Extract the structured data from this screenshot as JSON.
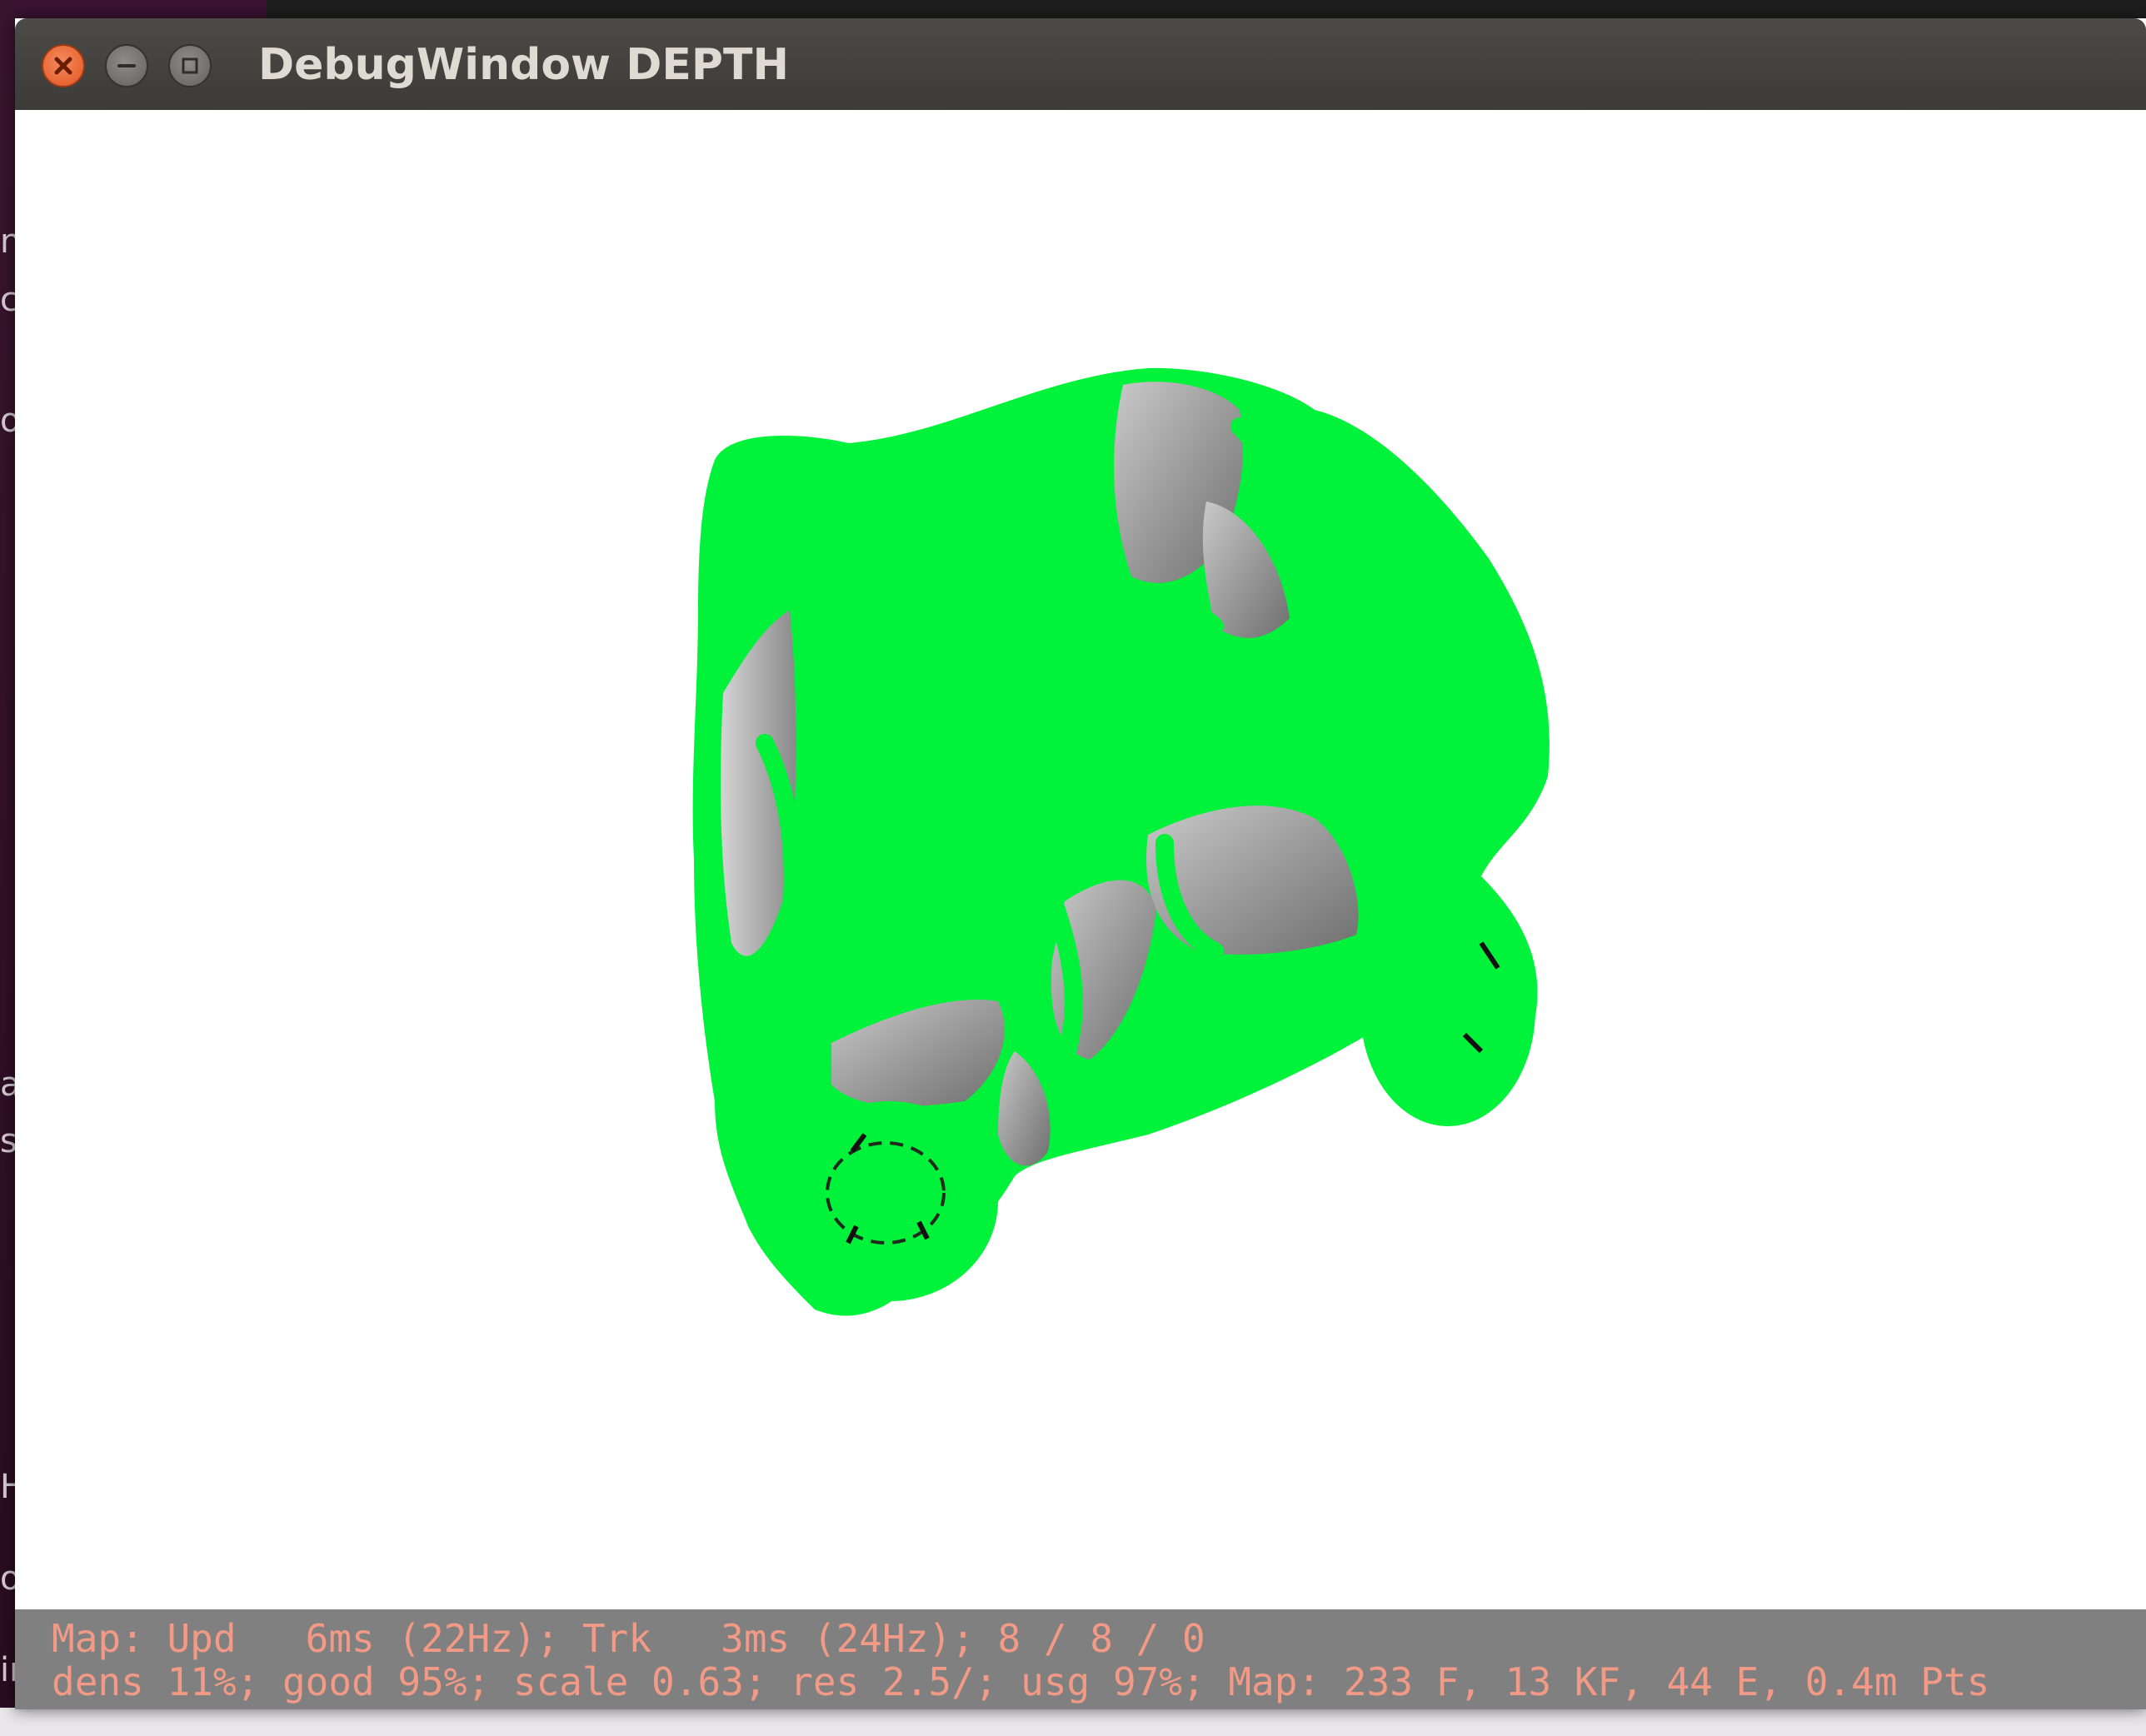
{
  "window": {
    "title": "DebugWindow DEPTH",
    "controls": [
      "close",
      "minimize",
      "maximize"
    ]
  },
  "viewport": {
    "content": "depth-rendered car model",
    "background": "#ffffff",
    "highlight_color": "#00ff33",
    "depth_shade_color": "#9a9a9a"
  },
  "status": {
    "line1": "Map: Upd   6ms (22Hz); Trk   3ms (24Hz); 8 / 8 / 0",
    "line2": "dens 11%; good 95%; scale 0.63; res 2.5/; usg 97%; Map: 233 F, 13 KF, 44 E, 0.4m Pts"
  },
  "desktop_edge": {
    "glyphs": [
      "n",
      "c",
      "o",
      "a",
      "s",
      "H",
      "or",
      "ir"
    ]
  },
  "colors": {
    "titlebar": "#3c3b37",
    "close_button": "#e2561f",
    "status_background": "#808080",
    "status_text": "#f29a86"
  }
}
